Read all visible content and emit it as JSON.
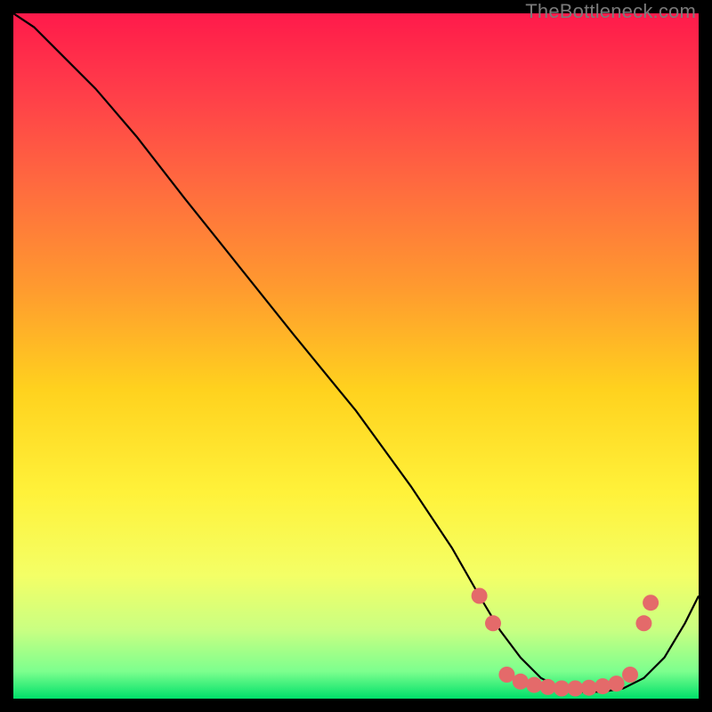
{
  "watermark": "TheBottleneck.com",
  "chart_data": {
    "type": "line",
    "title": "",
    "xlabel": "",
    "ylabel": "",
    "xlim": [
      0,
      100
    ],
    "ylim": [
      0,
      100
    ],
    "grid": false,
    "background_gradient": {
      "direction": "vertical",
      "stops": [
        {
          "pos": 0.0,
          "color": "#ff1a4b"
        },
        {
          "pos": 0.12,
          "color": "#ff3f49"
        },
        {
          "pos": 0.25,
          "color": "#ff6a3f"
        },
        {
          "pos": 0.4,
          "color": "#ff9a2f"
        },
        {
          "pos": 0.55,
          "color": "#ffd21e"
        },
        {
          "pos": 0.7,
          "color": "#fff23a"
        },
        {
          "pos": 0.82,
          "color": "#f4ff66"
        },
        {
          "pos": 0.9,
          "color": "#c9ff82"
        },
        {
          "pos": 0.96,
          "color": "#7dff8e"
        },
        {
          "pos": 1.0,
          "color": "#00e06a"
        }
      ]
    },
    "series": [
      {
        "name": "bottleneck-curve",
        "color": "#000000",
        "width": 2.2,
        "x": [
          0,
          3,
          7,
          12,
          18,
          25,
          33,
          41,
          50,
          58,
          64,
          68,
          71,
          74,
          77,
          80,
          83,
          86,
          89,
          92,
          95,
          98,
          100
        ],
        "y": [
          100,
          98,
          94,
          89,
          82,
          73,
          63,
          53,
          42,
          31,
          22,
          15,
          10,
          6,
          3,
          1.5,
          1,
          1,
          1.5,
          3,
          6,
          11,
          15
        ]
      }
    ],
    "markers": {
      "name": "trough-dots",
      "color": "#e46a6a",
      "radius": 9,
      "points": [
        {
          "x": 68,
          "y": 15
        },
        {
          "x": 70,
          "y": 11
        },
        {
          "x": 72,
          "y": 3.5
        },
        {
          "x": 74,
          "y": 2.5
        },
        {
          "x": 76,
          "y": 2
        },
        {
          "x": 78,
          "y": 1.7
        },
        {
          "x": 80,
          "y": 1.5
        },
        {
          "x": 82,
          "y": 1.5
        },
        {
          "x": 84,
          "y": 1.6
        },
        {
          "x": 86,
          "y": 1.8
        },
        {
          "x": 88,
          "y": 2.2
        },
        {
          "x": 90,
          "y": 3.5
        },
        {
          "x": 92,
          "y": 11
        },
        {
          "x": 93,
          "y": 14
        }
      ]
    }
  }
}
